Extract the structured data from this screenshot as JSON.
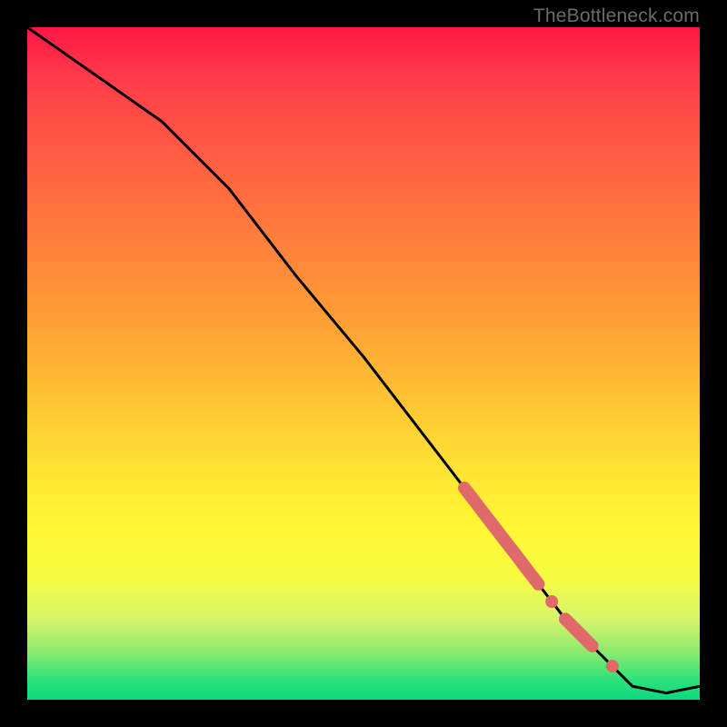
{
  "attribution": "TheBottleneck.com",
  "chart_data": {
    "type": "line",
    "title": "",
    "xlabel": "",
    "ylabel": "",
    "xlim": [
      0,
      100
    ],
    "ylim": [
      0,
      100
    ],
    "grid": false,
    "legend": false,
    "series": [
      {
        "name": "curve",
        "x": [
          0,
          10,
          20,
          30,
          40,
          50,
          60,
          70,
          80,
          90,
          95,
          100
        ],
        "y": [
          100,
          93,
          86,
          76,
          63,
          51,
          38,
          25,
          12,
          2,
          1,
          2
        ],
        "color": "#000000"
      }
    ],
    "highlights": [
      {
        "name": "segment-1",
        "x_start": 65,
        "x_end": 76,
        "thick": true,
        "color": "#e06a6a"
      },
      {
        "name": "dot-1",
        "x": 78,
        "color": "#e06a6a"
      },
      {
        "name": "segment-2",
        "x_start": 80,
        "x_end": 84,
        "thick": true,
        "color": "#e06a6a"
      },
      {
        "name": "dot-2",
        "x": 87,
        "color": "#e06a6a"
      }
    ],
    "background_gradient": {
      "top": "#ff1744",
      "mid": "#ffe933",
      "bottom": "#0bd97d"
    }
  }
}
